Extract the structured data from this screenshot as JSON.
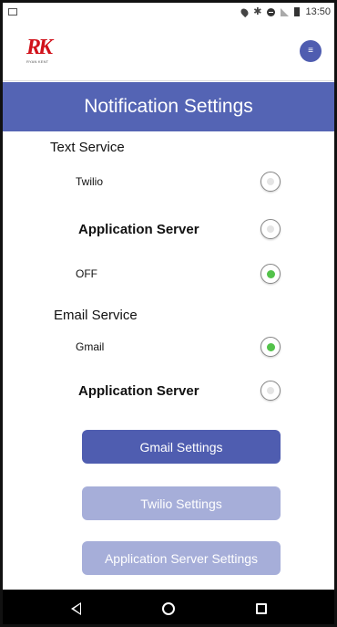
{
  "status_bar": {
    "time": "13:50",
    "icons": [
      "image-icon",
      "location-icon",
      "bluetooth-icon",
      "do-not-disturb-icon",
      "signal-icon",
      "battery-icon"
    ]
  },
  "header": {
    "logo_mark": "RK",
    "logo_text": "RYAN KENT",
    "menu_label": "≡"
  },
  "title": "Notification Settings",
  "text_service": {
    "heading": "Text Service",
    "options": [
      {
        "label": "Twilio",
        "checked": false
      },
      {
        "label": "Application Server",
        "checked": false
      },
      {
        "label": "OFF",
        "checked": true
      }
    ]
  },
  "email_service": {
    "heading": "Email Service",
    "options": [
      {
        "label": "Gmail",
        "checked": true
      },
      {
        "label": "Application Server",
        "checked": false
      }
    ]
  },
  "buttons": {
    "gmail": "Gmail Settings",
    "twilio": "Twilio Settings",
    "app_server": "Application Server Settings"
  },
  "colors": {
    "primary": "#4f5db0",
    "disabled": "#a6aed9",
    "checked": "#53c24a",
    "logo": "#d1121b"
  }
}
